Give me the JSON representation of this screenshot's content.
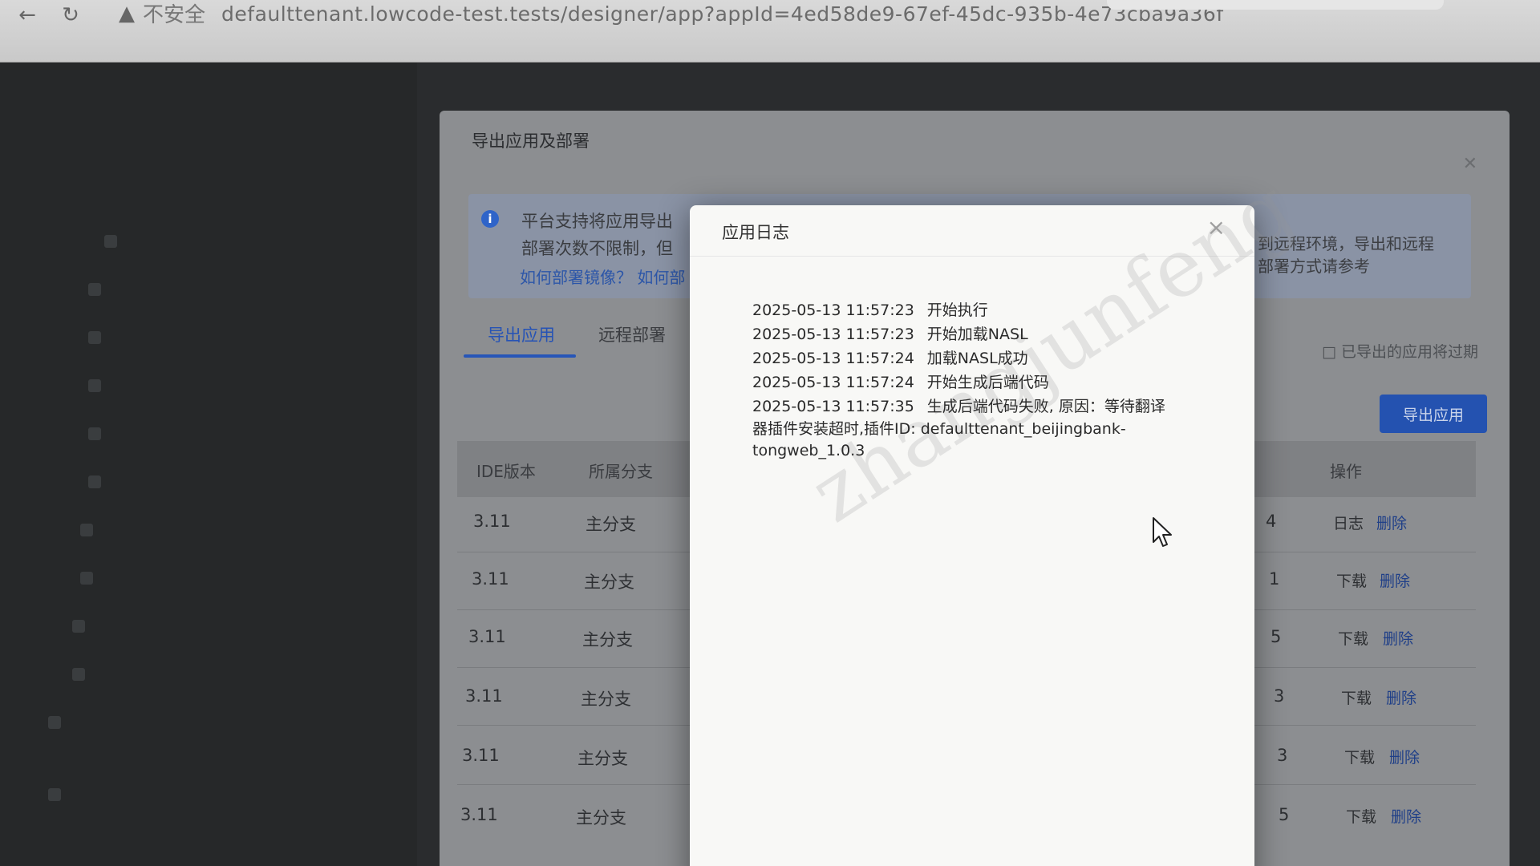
{
  "browser": {
    "insecure_label": "不安全",
    "url": "defaulttenant.lowcode-test.tests/designer/app?appId=4ed58de9-67ef-45dc-935b-4e73cba9a36f"
  },
  "export_dialog": {
    "title": "导出应用及部署",
    "info_line1": "平台支持将应用导出",
    "info_line2": "部署次数不限制，但",
    "info_links": "如何部署镜像？ 如何部",
    "info_right1": "到远程环境，导出和远程",
    "info_right2": "部署方式请参考",
    "tabs": [
      {
        "label": "导出应用"
      },
      {
        "label": "远程部署"
      }
    ],
    "exported_note": "已导出的应用将过期",
    "export_button": "导出应用",
    "columns": [
      "IDE版本",
      "所属分支",
      "操作"
    ],
    "rows": [
      {
        "ide": "3.11",
        "branch": "主分支",
        "tail": "4",
        "action1": "日志",
        "action2": "删除"
      },
      {
        "ide": "3.11",
        "branch": "主分支",
        "tail": "1",
        "action1": "下载",
        "action2": "删除"
      },
      {
        "ide": "3.11",
        "branch": "主分支",
        "tail": "5",
        "action1": "下载",
        "action2": "删除"
      },
      {
        "ide": "3.11",
        "branch": "主分支",
        "tail": "3",
        "action1": "下载",
        "action2": "删除"
      },
      {
        "ide": "3.11",
        "branch": "主分支",
        "tail": "3",
        "action1": "下载",
        "action2": "删除"
      },
      {
        "ide": "3.11",
        "branch": "主分支",
        "tail": "5",
        "action1": "下载",
        "action2": "删除"
      }
    ]
  },
  "log_dialog": {
    "title": "应用日志",
    "close": "×",
    "entries": [
      {
        "time": "2025-05-13 11:57:23",
        "msg": "开始执行"
      },
      {
        "time": "2025-05-13 11:57:23",
        "msg": "开始加载NASL"
      },
      {
        "time": "2025-05-13 11:57:24",
        "msg": "加载NASL成功"
      },
      {
        "time": "2025-05-13 11:57:24",
        "msg": "开始生成后端代码"
      },
      {
        "time": "2025-05-13 11:57:35",
        "msg": "生成后端代码失败, 原因：等待翻译"
      }
    ],
    "wrap_line1": "器插件安装超时,插件ID: defaulttenant_beijingbank-",
    "wrap_line2": "tongweb_1.0.3",
    "watermark": "zhangjunfeng"
  }
}
